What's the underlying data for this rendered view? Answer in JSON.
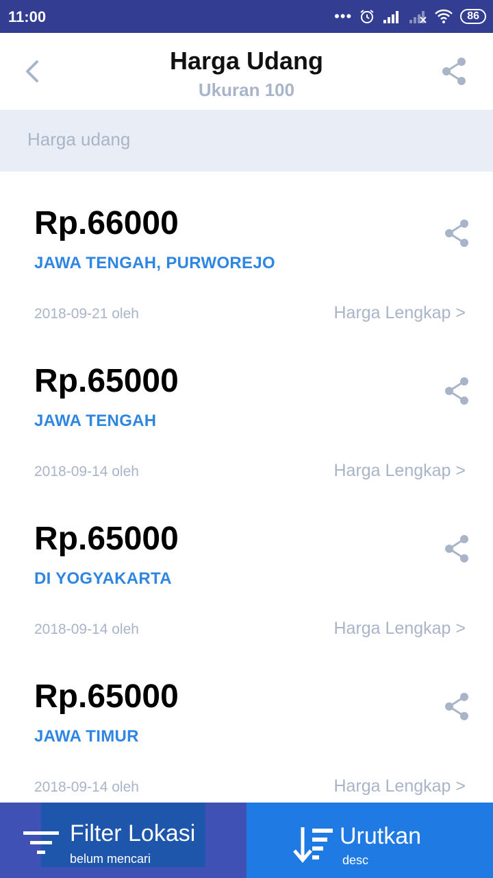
{
  "status": {
    "time": "11:00",
    "battery": "86"
  },
  "header": {
    "title": "Harga Udang",
    "subtitle": "Ukuran 100"
  },
  "search": {
    "label": "Harga udang"
  },
  "items": [
    {
      "price": "Rp.66000",
      "location": "JAWA TENGAH, PURWOREJO",
      "date": "2018-09-21 oleh",
      "detail": "Harga Lengkap >"
    },
    {
      "price": "Rp.65000",
      "location": "JAWA TENGAH",
      "date": "2018-09-14 oleh",
      "detail": "Harga Lengkap >"
    },
    {
      "price": "Rp.65000",
      "location": "DI YOGYAKARTA",
      "date": "2018-09-14 oleh",
      "detail": "Harga Lengkap >"
    },
    {
      "price": "Rp.65000",
      "location": "JAWA TIMUR",
      "date": "2018-09-14 oleh",
      "detail": "Harga Lengkap >"
    }
  ],
  "bottom": {
    "filter": {
      "label": "Filter Lokasi",
      "sub": "belum mencari"
    },
    "sort": {
      "label": "Urutkan",
      "sub": "desc"
    }
  },
  "colors": {
    "accent": "#2f86e2",
    "statusbar": "#333d91",
    "filter_bg": "#3f51b5",
    "sort_bg": "#1f7be3",
    "muted": "#a9b4c8"
  }
}
